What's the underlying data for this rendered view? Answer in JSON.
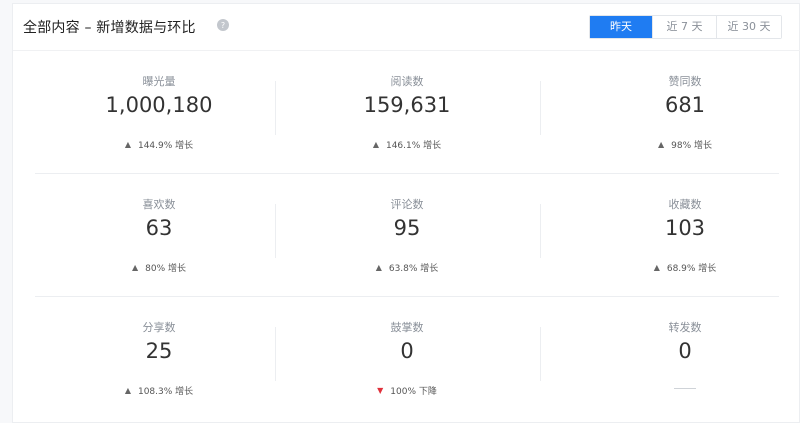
{
  "header": {
    "title": "全部内容 – 新增数据与环比",
    "help_icon": "question-circle-icon",
    "ranges": [
      {
        "label": "昨天",
        "active": true
      },
      {
        "label": "近 7 天",
        "active": false
      },
      {
        "label": "近 30 天",
        "active": false
      }
    ]
  },
  "colors": {
    "accent": "#1f7cf2",
    "decrease": "#e0303b",
    "increase_arrow": "#666666"
  },
  "metrics": [
    [
      {
        "label": "曝光量",
        "value": "1,000,180",
        "direction": "up",
        "change": "144.9% 增长"
      },
      {
        "label": "阅读数",
        "value": "159,631",
        "direction": "up",
        "change": "146.1% 增长"
      },
      {
        "label": "赞同数",
        "value": "681",
        "direction": "up",
        "change": "98% 增长"
      }
    ],
    [
      {
        "label": "喜欢数",
        "value": "63",
        "direction": "up",
        "change": "80% 增长"
      },
      {
        "label": "评论数",
        "value": "95",
        "direction": "up",
        "change": "63.8% 增长"
      },
      {
        "label": "收藏数",
        "value": "103",
        "direction": "up",
        "change": "68.9% 增长"
      }
    ],
    [
      {
        "label": "分享数",
        "value": "25",
        "direction": "up",
        "change": "108.3% 增长"
      },
      {
        "label": "鼓掌数",
        "value": "0",
        "direction": "down",
        "change": "100% 下降"
      },
      {
        "label": "转发数",
        "value": "0",
        "direction": "none",
        "change": ""
      }
    ]
  ]
}
